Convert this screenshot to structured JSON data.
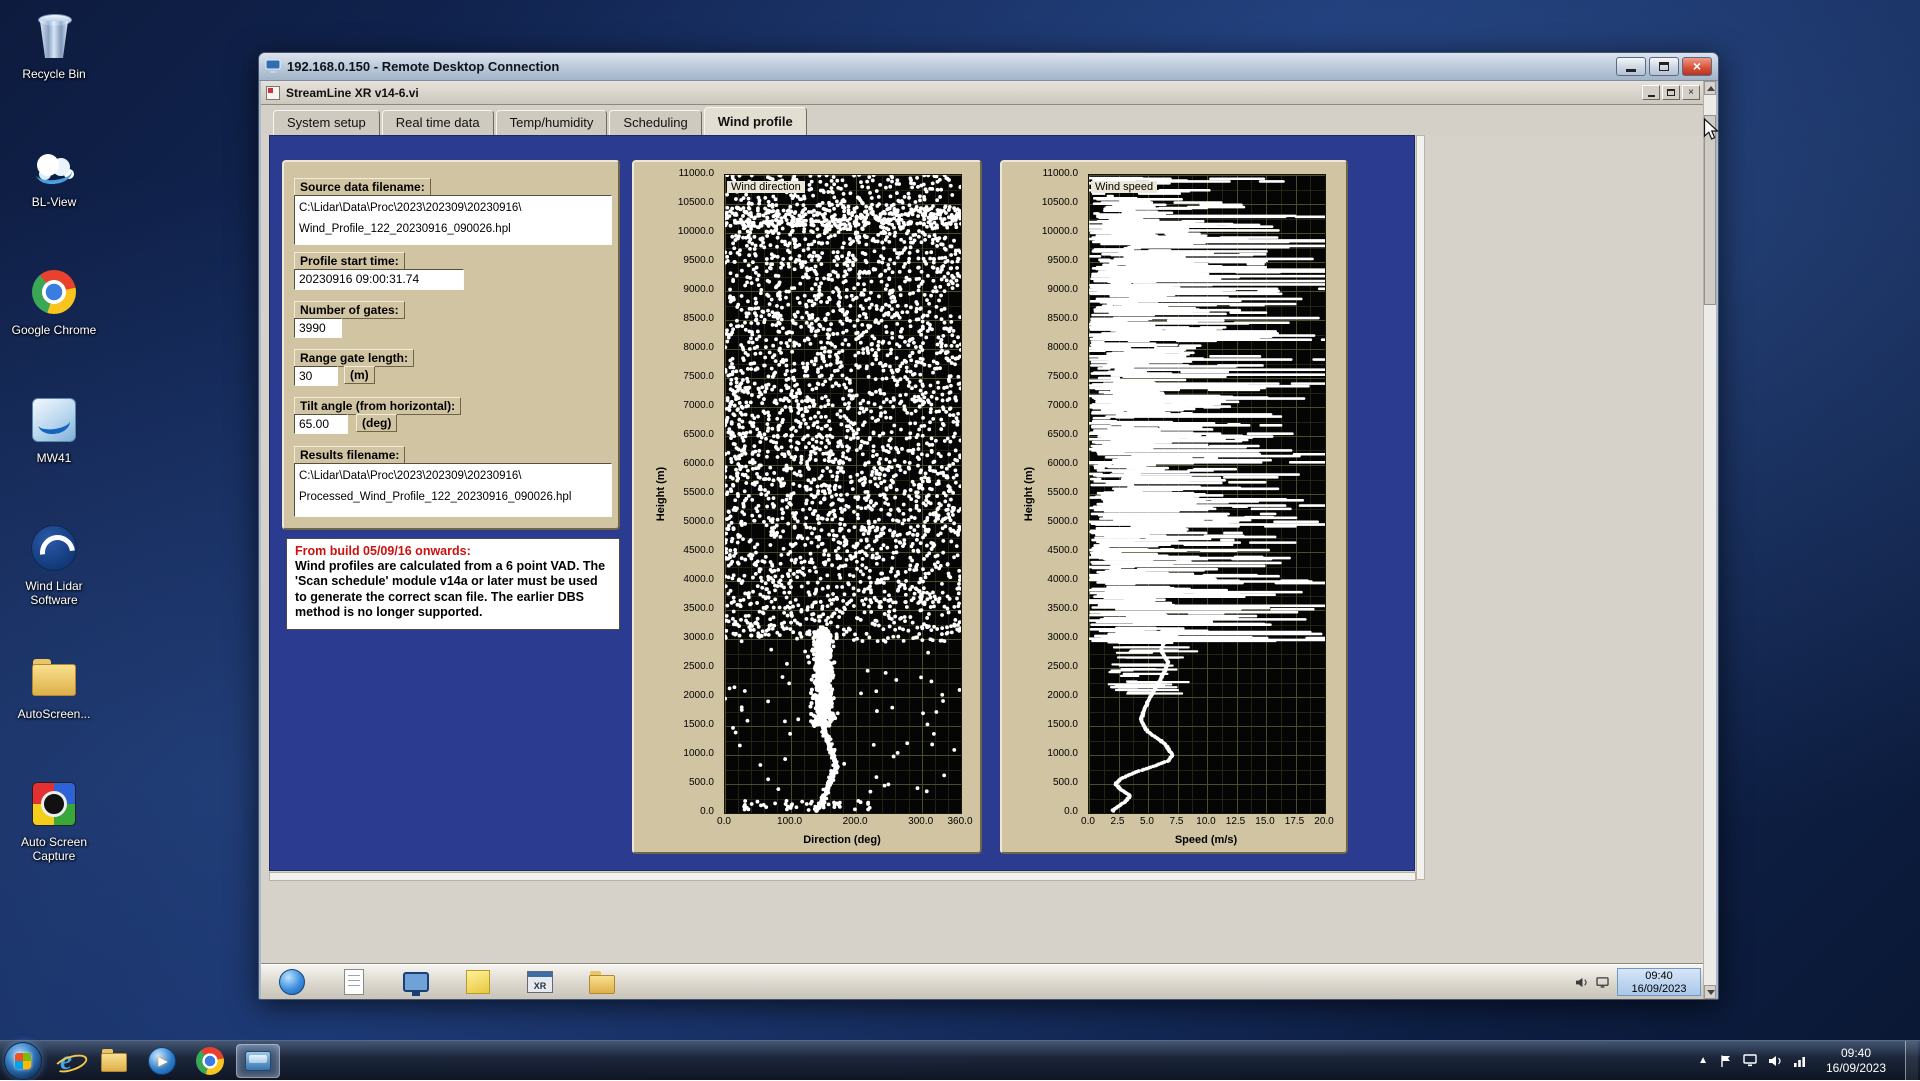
{
  "icons": {
    "ie_glyph": "e",
    "play_glyph": "▶",
    "tray_arrow_glyph": "▲"
  },
  "desktop": {
    "icons": [
      {
        "label": "Recycle Bin",
        "icon": "recycle-bin-icon"
      },
      {
        "label": "BL-View",
        "icon": "bl-view-icon"
      },
      {
        "label": "Google Chrome",
        "icon": "chrome-icon"
      },
      {
        "label": "MW41",
        "icon": "mw41-icon"
      },
      {
        "label": "Wind Lidar Software",
        "icon": "wind-lidar-icon"
      },
      {
        "label": "AutoScreen...",
        "icon": "folder-icon"
      },
      {
        "label": "Auto Screen Capture",
        "icon": "auto-screen-capture-icon"
      }
    ]
  },
  "rdp": {
    "title": "192.168.0.150 - Remote Desktop Connection",
    "app": {
      "title": "StreamLine XR v14-6.vi",
      "tabs": [
        {
          "label": "System setup",
          "active": false
        },
        {
          "label": "Real time data",
          "active": false
        },
        {
          "label": "Temp/humidity",
          "active": false
        },
        {
          "label": "Scheduling",
          "active": false
        },
        {
          "label": "Wind profile",
          "active": true
        }
      ],
      "fields": {
        "source_label": "Source data filename:",
        "source_value_line1": "C:\\Lidar\\Data\\Proc\\2023\\202309\\20230916\\",
        "source_value_line2": "Wind_Profile_122_20230916_090026.hpl",
        "start_time_label": "Profile start time:",
        "start_time_value": "20230916 09:00:31.74",
        "gates_label": "Number of gates:",
        "gates_value": "3990",
        "range_label": "Range gate length:",
        "range_value": "30",
        "range_unit": "(m)",
        "tilt_label": "Tilt angle (from horizontal):",
        "tilt_value": "65.00",
        "tilt_unit": "(deg)",
        "results_label": "Results filename:",
        "results_value_line1": "C:\\Lidar\\Data\\Proc\\2023\\202309\\20230916\\",
        "results_value_line2": "Processed_Wind_Profile_122_20230916_090026.hpl"
      },
      "note": {
        "title": "From build 05/09/16 onwards:",
        "body": "Wind profiles are calculated from a 6 point VAD. The 'Scan schedule' module v14a or later must be used to generate the correct scan file. The earlier DBS method is no longer supported."
      }
    },
    "remote_taskbar": {
      "quick_launch": [
        {
          "icon": "browser"
        },
        {
          "icon": "notepad"
        },
        {
          "icon": "monitor"
        },
        {
          "icon": "notes"
        },
        {
          "icon": "xr-app",
          "label": "XR"
        },
        {
          "icon": "folder"
        }
      ],
      "clock_time": "09:40",
      "clock_date": "16/09/2023"
    }
  },
  "chart_data": [
    {
      "type": "scatter",
      "title": "Wind direction",
      "xlabel": "Direction (deg)",
      "ylabel": "Height (m)",
      "xlim": [
        0,
        360
      ],
      "ylim": [
        0,
        11000
      ],
      "xticks": [
        0,
        100,
        200,
        300,
        360
      ],
      "ytick_step": 500,
      "grid": true,
      "legend_position": "top-left-inside",
      "grid_x_minor": 20,
      "grid_x_major": 100,
      "grid_y_minor": 250,
      "grid_y_major": 500,
      "profile_points_h_dir": [
        [
          3200,
          150
        ],
        [
          3000,
          149
        ],
        [
          2800,
          152
        ],
        [
          2600,
          148
        ],
        [
          2400,
          151
        ],
        [
          2200,
          149
        ],
        [
          2000,
          152
        ],
        [
          1800,
          150
        ],
        [
          1600,
          149
        ],
        [
          1400,
          153
        ],
        [
          1200,
          158
        ],
        [
          1000,
          164
        ],
        [
          900,
          168
        ],
        [
          800,
          170
        ],
        [
          700,
          167
        ],
        [
          600,
          163
        ],
        [
          500,
          160
        ],
        [
          400,
          156
        ],
        [
          300,
          152
        ],
        [
          200,
          148
        ],
        [
          100,
          143
        ],
        [
          50,
          140
        ]
      ],
      "blob": {
        "height_range": [
          1500,
          3150
        ],
        "center": 150,
        "sd": 15,
        "count": 650
      },
      "noise": {
        "seed": 12,
        "count": 3200,
        "height_range": [
          2950,
          11000
        ],
        "top_cluster": {
          "center": 10250,
          "spread": 360,
          "count": 320
        },
        "sparse_below": {
          "height_range": [
            300,
            2900
          ],
          "count": 60
        }
      },
      "surface_scatter": {
        "height_range": [
          30,
          210
        ],
        "direction_range": [
          15,
          230
        ],
        "count": 45
      }
    },
    {
      "type": "scatter",
      "title": "Wind speed",
      "xlabel": "Speed (m/s)",
      "ylabel": "Height (m)",
      "xlim": [
        0,
        20
      ],
      "ylim": [
        0,
        11000
      ],
      "xticks": [
        0,
        2.5,
        5,
        7.5,
        10,
        12.5,
        15,
        17.5,
        20
      ],
      "ytick_step": 500,
      "grid": true,
      "legend_position": "top-left-inside",
      "grid_x_minor": 1.25,
      "grid_x_major": 2.5,
      "grid_y_minor": 250,
      "grid_y_major": 500,
      "profile_points_h_speed": [
        [
          3000,
          6.5
        ],
        [
          2800,
          6.1
        ],
        [
          2600,
          6.7
        ],
        [
          2400,
          6.3
        ],
        [
          2200,
          5.8
        ],
        [
          2000,
          5.2
        ],
        [
          1800,
          4.7
        ],
        [
          1600,
          4.4
        ],
        [
          1400,
          5.0
        ],
        [
          1200,
          6.4
        ],
        [
          1000,
          7.1
        ],
        [
          900,
          6.7
        ],
        [
          800,
          5.4
        ],
        [
          700,
          3.9
        ],
        [
          600,
          2.8
        ],
        [
          500,
          2.2
        ],
        [
          400,
          2.7
        ],
        [
          300,
          3.5
        ],
        [
          200,
          3.1
        ],
        [
          100,
          2.4
        ],
        [
          50,
          2.0
        ]
      ],
      "noise_streaks": {
        "seed": 5,
        "height_range": [
          2950,
          11000
        ],
        "row_step": [
          10,
          22
        ],
        "speed_range": [
          0,
          20
        ]
      },
      "transition_streaks": {
        "height_range": [
          2050,
          2950
        ],
        "count": 30
      }
    }
  ],
  "taskbar": {
    "clock_time": "09:40",
    "clock_date": "16/09/2023"
  }
}
